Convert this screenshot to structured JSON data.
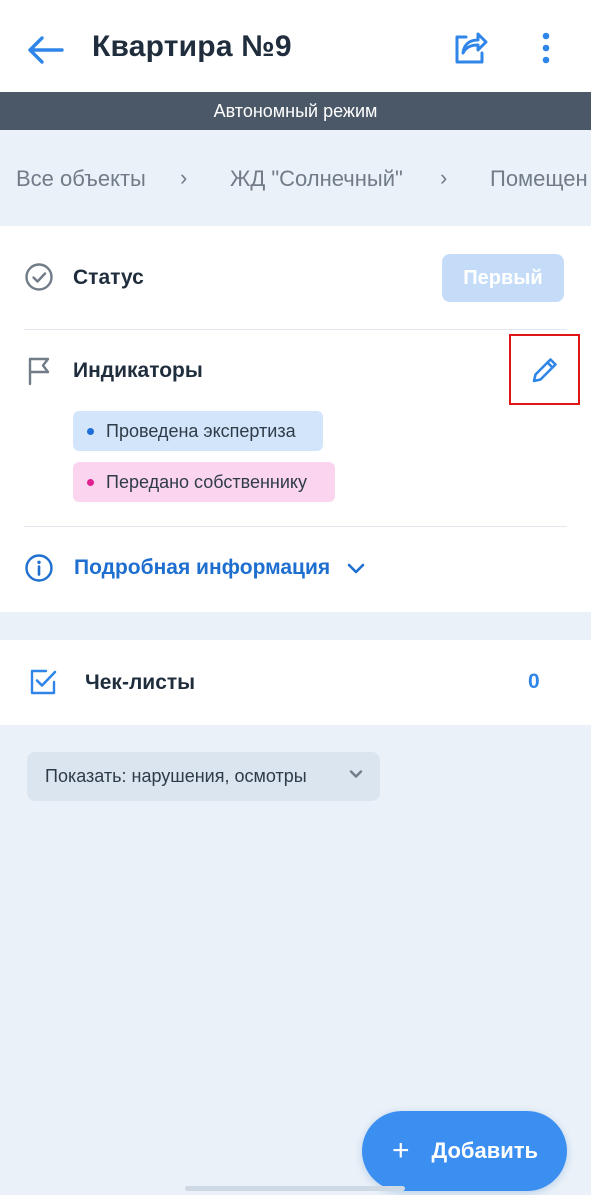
{
  "header": {
    "title": "Квартира №9"
  },
  "offline_banner": "Автономный режим",
  "breadcrumbs": [
    "Все объекты",
    "ЖД \"Солнечный\"",
    "Помещен"
  ],
  "status": {
    "label": "Статус",
    "value": "Первый"
  },
  "indicators": {
    "label": "Индикаторы",
    "items": [
      {
        "text": "Проведена экспертиза",
        "color": "#1e6fd9"
      },
      {
        "text": "Передано собственнику",
        "color": "#e0208e"
      }
    ]
  },
  "details": {
    "label": "Подробная информация"
  },
  "checklists": {
    "label": "Чек-листы",
    "count": "0"
  },
  "filter": {
    "label": "Показать: нарушения, осмотры"
  },
  "fab": {
    "plus": "+",
    "label": "Добавить"
  },
  "icons": {
    "back": "arrow-left-icon",
    "share": "share-icon",
    "more": "more-vertical-icon",
    "status": "check-circle-icon",
    "indicators": "flag-icon",
    "edit": "pencil-icon",
    "details": "info-icon",
    "expand": "chevron-down-icon",
    "checklist": "checkbox-icon"
  },
  "colors": {
    "accent": "#2f86e8",
    "offline_bar": "#4a5868",
    "background": "#eaf1f8"
  }
}
